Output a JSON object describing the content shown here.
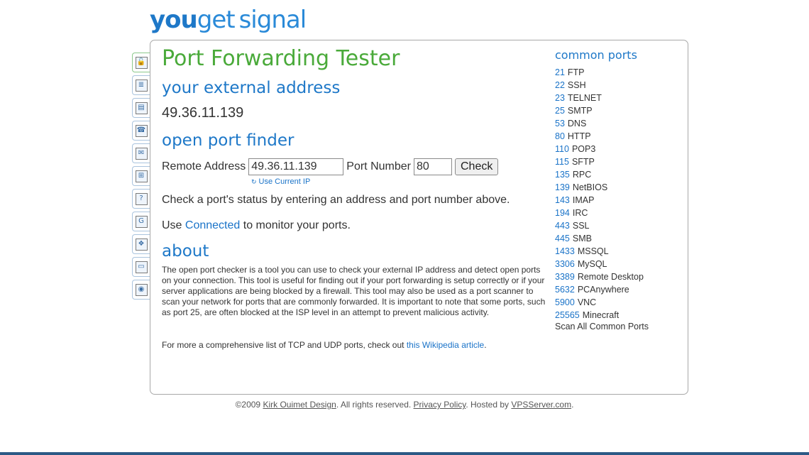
{
  "logo": {
    "part1": "you",
    "part2": "get",
    "part3": "signal"
  },
  "sidebar": {
    "items": [
      {
        "icon": "lock-icon",
        "glyph": "🔓"
      },
      {
        "icon": "document-icon",
        "glyph": "≣"
      },
      {
        "icon": "map-document-icon",
        "glyph": "▤"
      },
      {
        "icon": "phone-icon",
        "glyph": "☎"
      },
      {
        "icon": "mail-icon",
        "glyph": "✉"
      },
      {
        "icon": "network-icon",
        "glyph": "⊞"
      },
      {
        "icon": "help-icon",
        "glyph": "?"
      },
      {
        "icon": "google-icon",
        "glyph": "G"
      },
      {
        "icon": "windows-icon",
        "glyph": "❖"
      },
      {
        "icon": "drive-icon",
        "glyph": "▭"
      },
      {
        "icon": "globe-icon",
        "glyph": "◉"
      }
    ]
  },
  "main": {
    "title": "Port Forwarding Tester",
    "external_heading": "your external address",
    "external_ip": "49.36.11.139",
    "finder_heading": "open port finder",
    "remote_address_label": "Remote Address",
    "remote_address_value": "49.36.11.139",
    "port_number_label": "Port Number",
    "port_number_value": "80",
    "check_label": "Check",
    "use_current_ip": "Use Current IP",
    "instructions": "Check a port's status by entering an address and port number above.",
    "connected_prefix": "Use",
    "connected_link": "Connected",
    "connected_suffix": "to monitor your ports.",
    "about_heading": "about",
    "about_text": "The open port checker is a tool you can use to check your external IP address and detect open ports on your connection. This tool is useful for finding out if your port forwarding is setup correctly or if your server applications are being blocked by a firewall. This tool may also be used as a port scanner to scan your network for ports that are commonly forwarded. It is important to note that some ports, such as port 25, are often blocked at the ISP level in an attempt to prevent malicious activity.",
    "more_prefix": "For more a comprehensive list of TCP and UDP ports, check out",
    "more_link": "this Wikipedia article",
    "more_suffix": "."
  },
  "common_ports": {
    "title": "common ports",
    "items": [
      {
        "port": "21",
        "name": "FTP"
      },
      {
        "port": "22",
        "name": "SSH"
      },
      {
        "port": "23",
        "name": "TELNET"
      },
      {
        "port": "25",
        "name": "SMTP"
      },
      {
        "port": "53",
        "name": "DNS"
      },
      {
        "port": "80",
        "name": "HTTP"
      },
      {
        "port": "110",
        "name": "POP3"
      },
      {
        "port": "115",
        "name": "SFTP"
      },
      {
        "port": "135",
        "name": "RPC"
      },
      {
        "port": "139",
        "name": "NetBIOS"
      },
      {
        "port": "143",
        "name": "IMAP"
      },
      {
        "port": "194",
        "name": "IRC"
      },
      {
        "port": "443",
        "name": "SSL"
      },
      {
        "port": "445",
        "name": "SMB"
      },
      {
        "port": "1433",
        "name": "MSSQL"
      },
      {
        "port": "3306",
        "name": "MySQL"
      },
      {
        "port": "3389",
        "name": "Remote Desktop"
      },
      {
        "port": "5632",
        "name": "PCAnywhere"
      },
      {
        "port": "5900",
        "name": "VNC"
      },
      {
        "port": "25565",
        "name": "Minecraft"
      }
    ],
    "scan_all": "Scan All Common Ports"
  },
  "footer": {
    "copyright": "©2009",
    "author_link": "Kirk Ouimet Design",
    "rights": ". All rights reserved.",
    "privacy_link": "Privacy Policy",
    "hosted_by": ". Hosted by",
    "host_link": "VPSServer.com",
    "end": "."
  },
  "colors": {
    "title_green": "#4aaa3a",
    "heading_blue": "#1e78c8",
    "link_blue": "#1a73c8"
  }
}
